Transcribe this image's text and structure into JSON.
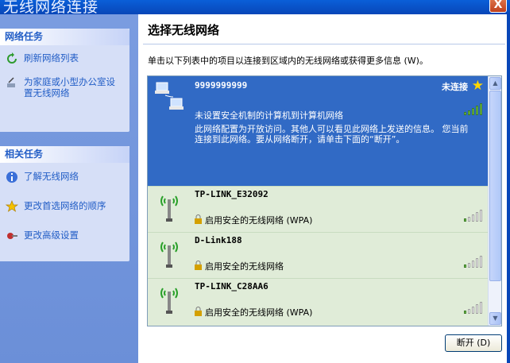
{
  "window": {
    "title": "无线网络连接",
    "close_label": "X"
  },
  "left_pane": {
    "network_tasks": {
      "header": "网络任务",
      "items": [
        {
          "label": "刷新网络列表",
          "icon": "refresh-icon"
        },
        {
          "label": "为家庭或小型办公室设置无线网络",
          "icon": "wireless-setup-icon"
        }
      ]
    },
    "related_tasks": {
      "header": "相关任务",
      "items": [
        {
          "label": "了解无线网络",
          "icon": "info-icon"
        },
        {
          "label": "更改首选网络的顺序",
          "icon": "star-icon"
        },
        {
          "label": "更改高级设置",
          "icon": "settings-icon"
        }
      ]
    }
  },
  "main": {
    "title": "选择无线网络",
    "description": "单击以下列表中的项目以连接到区域内的无线网络或获得更多信息 (W)。",
    "networks": [
      {
        "ssid": "9999999999",
        "status": "未连接",
        "security": "未设置安全机制的计算机到计算机网络",
        "info": "此网络配置为开放访问。其他人可以看见此网络上发送的信息。 您当前连接到此网络。要从网络断开，请单击下面的“断开”。",
        "signal_level": 5
      },
      {
        "ssid": "TP-LINK_E32092",
        "security": "启用安全的无线网络 (WPA)",
        "signal_level": 1
      },
      {
        "ssid": "D-Link188",
        "security": "启用安全的无线网络",
        "signal_level": 1
      },
      {
        "ssid": "TP-LINK_C28AA6",
        "security": "启用安全的无线网络 (WPA)",
        "signal_level": 1
      }
    ],
    "disconnect_label": "断开 (D)"
  },
  "colors": {
    "selected": "#316ac5",
    "task_link": "#215dc6",
    "pane_bg": "#6b8fd8"
  }
}
